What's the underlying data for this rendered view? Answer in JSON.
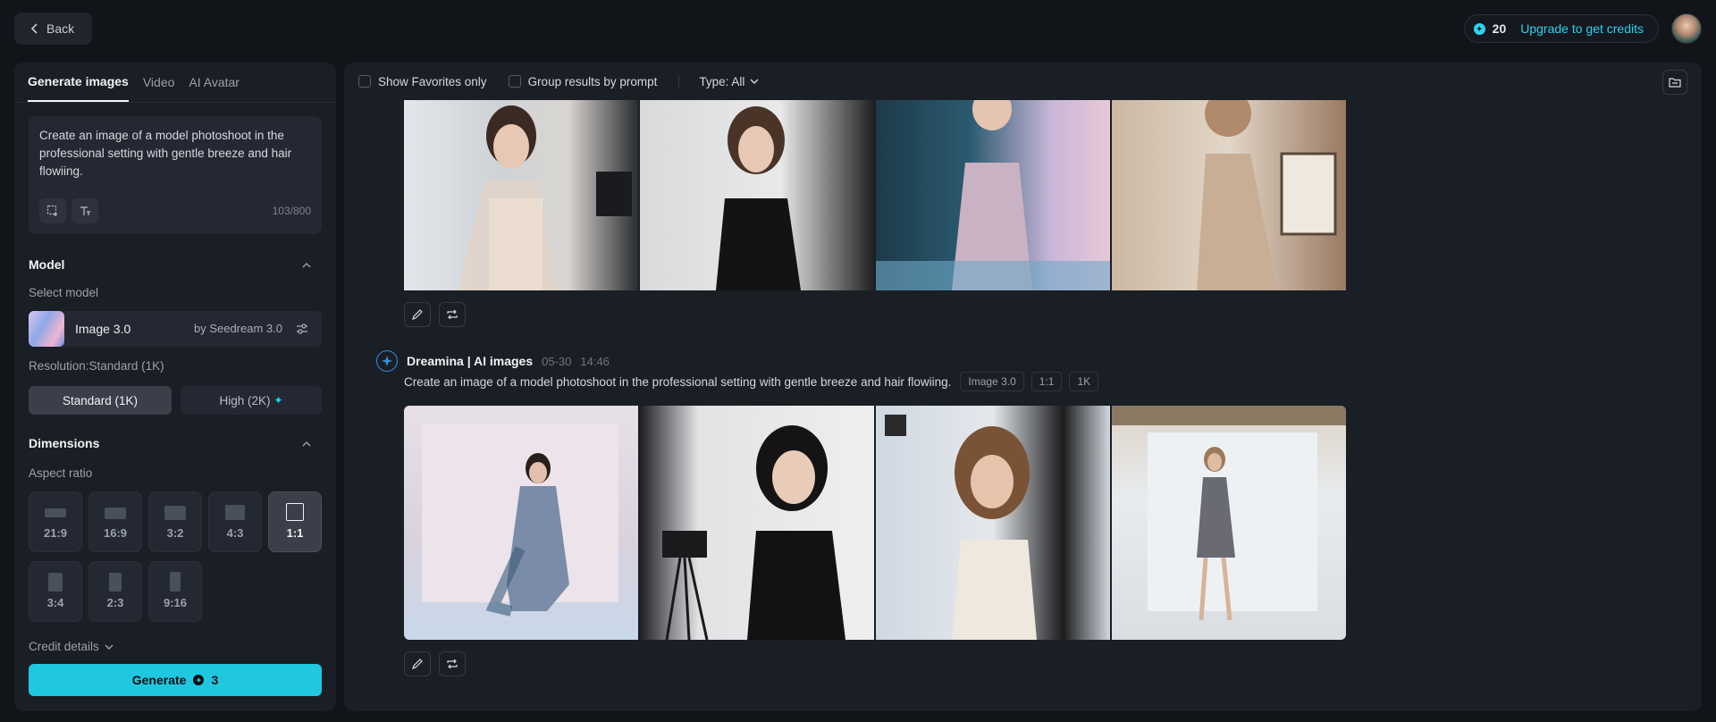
{
  "topbar": {
    "back_label": "Back",
    "credits": "20",
    "upgrade_label": "Upgrade to get credits"
  },
  "left_panel": {
    "tabs": [
      {
        "label": "Generate images",
        "active": true
      },
      {
        "label": "Video",
        "active": false
      },
      {
        "label": "AI Avatar",
        "active": false
      }
    ],
    "prompt": {
      "text": "Create an image of a model photoshoot in the professional setting with gentle breeze and hair flowiing.",
      "char_count": "103/800"
    },
    "model_section": {
      "title": "Model",
      "select_label": "Select model",
      "model_name": "Image 3.0",
      "model_by": "by Seedream 3.0"
    },
    "resolution": {
      "label": "Resolution:Standard (1K)",
      "options": [
        "Standard (1K)",
        "High (2K)"
      ],
      "selected": "Standard (1K)"
    },
    "dimensions": {
      "title": "Dimensions",
      "aspect_label": "Aspect ratio",
      "ratios": [
        "21:9",
        "16:9",
        "3:2",
        "4:3",
        "1:1",
        "3:4",
        "2:3",
        "9:16"
      ],
      "selected": "1:1"
    },
    "credit_details_label": "Credit details",
    "generate": {
      "label": "Generate",
      "cost": "3"
    }
  },
  "main": {
    "filters": {
      "favorites_label": "Show Favorites only",
      "group_label": "Group results by prompt",
      "type_label": "Type: All"
    },
    "generation": {
      "brand": "Dreamina | AI images",
      "date": "05-30",
      "time": "14:46",
      "prompt": "Create an image of a model photoshoot in the professional setting with gentle breeze and hair flowiing.",
      "tags": [
        "Image 3.0",
        "1:1",
        "1K"
      ]
    }
  },
  "colors": {
    "accent": "#1fc8e0",
    "background": "#111419",
    "panel": "#1a1e25"
  }
}
